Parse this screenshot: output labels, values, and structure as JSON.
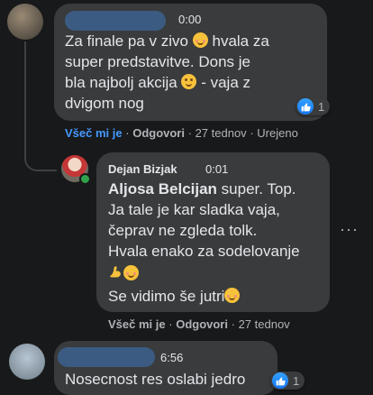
{
  "comment1": {
    "time": "0:00",
    "lines": [
      "Za finale pa v zivo",
      "hvala za",
      "super predstavitve. Dons je",
      "bla najbolj akcija",
      "- vaja z",
      "dvigom nog"
    ],
    "reaction_count": "1",
    "actions": {
      "like": "Všeč mi je",
      "reply": "Odgovori",
      "age": "27 tednov",
      "edited": "Urejeno"
    }
  },
  "reply": {
    "author": "Dejan Bizjak",
    "time": "0:01",
    "tag": "Aljosa Belcijan",
    "lines": [
      "super. Top.",
      "Ja tale je kar sladka vaja,",
      "čeprav ne zgleda tolk.",
      "Hvala enako za sodelovanje",
      "Se vidimo še jutri"
    ],
    "more": "···",
    "actions": {
      "like": "Všeč mi je",
      "reply": "Odgovori",
      "age": "27 tednov"
    }
  },
  "comment2": {
    "time": "6:56",
    "text": "Nosecnost res oslabi jedro",
    "reaction_count": "1"
  },
  "separator": "·",
  "colors": {
    "background": "#18191a",
    "bubble": "#3a3b3c",
    "like_blue": "#1877f2",
    "online_green": "#31a24c"
  },
  "icons": [
    "thumbs-up-icon",
    "blush-emoji-icon",
    "wink-emoji-icon",
    "muscle-emoji-icon",
    "more-icon"
  ]
}
